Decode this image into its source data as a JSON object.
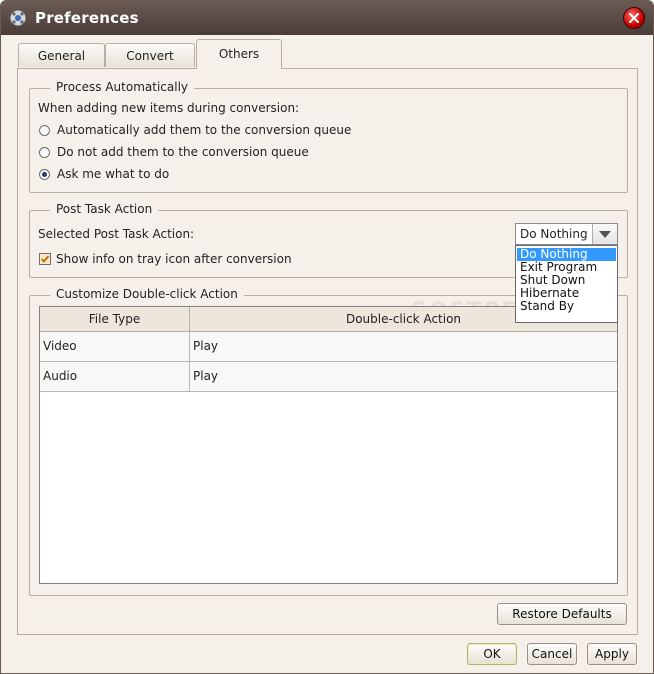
{
  "window": {
    "title": "Preferences"
  },
  "tabs": [
    {
      "label": "General",
      "active": false
    },
    {
      "label": "Convert",
      "active": false
    },
    {
      "label": "Others",
      "active": true
    }
  ],
  "process_auto": {
    "legend": "Process Automatically",
    "prompt": "When adding new items during conversion:",
    "options": [
      {
        "label": "Automatically add them to the conversion queue",
        "checked": false
      },
      {
        "label": "Do not add them to the conversion queue",
        "checked": false
      },
      {
        "label": "Ask me what to do",
        "checked": true
      }
    ]
  },
  "post_task": {
    "legend": "Post Task Action",
    "label": "Selected Post Task Action:",
    "selected": "Do Nothing",
    "options": [
      "Do Nothing",
      "Exit Program",
      "Shut Down",
      "Hibernate",
      "Stand By"
    ],
    "tray_checkbox": {
      "label": "Show info on tray icon after conversion",
      "checked": true
    }
  },
  "double_click": {
    "legend": "Customize Double-click Action",
    "columns": [
      "File Type",
      "Double-click Action"
    ],
    "rows": [
      {
        "type": "Video",
        "action": "Play"
      },
      {
        "type": "Audio",
        "action": "Play"
      }
    ]
  },
  "buttons": {
    "restore": "Restore Defaults",
    "ok": "OK",
    "cancel": "Cancel",
    "apply": "Apply"
  },
  "watermark": "SOFTPEDIA",
  "colors": {
    "titlebar": "#4a3c37",
    "panel": "#f5f1ea",
    "selection": "#3399ff"
  }
}
